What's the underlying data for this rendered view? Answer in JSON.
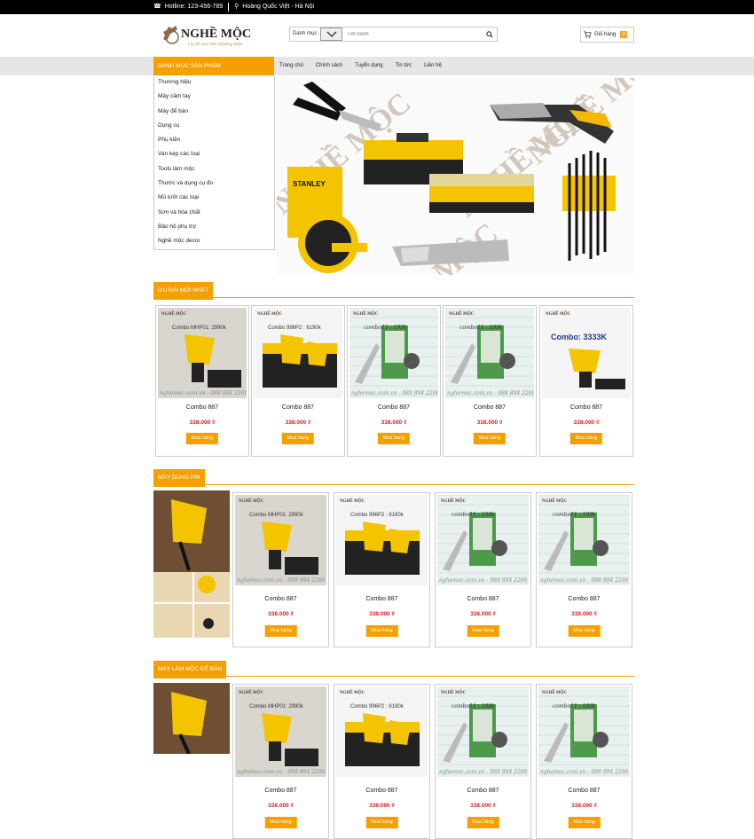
{
  "topbar": {
    "hotline": "Hotline: 123-456-789",
    "address": "Hoàng Quốc Việt - Hà Nội"
  },
  "logo": {
    "text": "NGHỀ MỘC",
    "tagline": "Uy tín tạo nên thương hiệu"
  },
  "search": {
    "category_label": "Danh mục",
    "placeholder": "Tìm kiếm"
  },
  "cart": {
    "label": "Giỏ hàng",
    "count": "0"
  },
  "nav": {
    "category_title": "Danh mục sản phẩm",
    "links": [
      "Trang chủ",
      "Chính sách",
      "Tuyển dụng",
      "Tin tức",
      "Liên hệ"
    ]
  },
  "categories": [
    "Thương hiệu",
    "Máy cầm tay",
    "Máy để bàn",
    "Dụng cụ",
    "Phụ kiện",
    "Van kẹp các loại",
    "Tools làm mộc",
    "Thước và dụng cụ đo",
    "Mũ lưỡi các loại",
    "Sơn và hóa chất",
    "Bảo hộ phụ trợ",
    "Nghề mộc decor"
  ],
  "banner": {
    "watermark": "NGHỀ MỘC",
    "stanley": "STANLEY"
  },
  "sections": [
    {
      "title": "Ưu đãi mới nhất",
      "products": [
        {
          "name": "Combo 887",
          "price": "338.000 ₫",
          "button": "Mua hàng",
          "caption": "Combo MHP01: 2990k",
          "kind": "drill"
        },
        {
          "name": "Combo 887",
          "price": "338.000 ₫",
          "button": "Mua hàng",
          "caption": "Combo 996P2 : 6190k",
          "kind": "case"
        },
        {
          "name": "Combo 887",
          "price": "338.000 ₫",
          "button": "Mua hàng",
          "caption": "combo11 : 199k",
          "kind": "ruler"
        },
        {
          "name": "Combo 887",
          "price": "338.000 ₫",
          "button": "Mua hàng",
          "caption": "combo11 : 199k",
          "kind": "ruler"
        },
        {
          "name": "Combo 887",
          "price": "338.000 ₫",
          "button": "Mua hàng",
          "caption": "Combo: 3333K",
          "kind": "drill2"
        }
      ]
    },
    {
      "title": "Máy dùng pin",
      "products": [
        {
          "name": "Combo 887",
          "price": "338.000 ₫",
          "button": "Mua hàng",
          "caption": "Combo MHP01: 2990k",
          "kind": "drill"
        },
        {
          "name": "Combo 887",
          "price": "338.000 ₫",
          "button": "Mua hàng",
          "caption": "Combo 996P2 : 6190k",
          "kind": "case"
        },
        {
          "name": "Combo 887",
          "price": "338.000 ₫",
          "button": "Mua hàng",
          "caption": "combo11 : 199k",
          "kind": "ruler"
        },
        {
          "name": "Combo 887",
          "price": "338.000 ₫",
          "button": "Mua hàng",
          "caption": "combo11 : 199k",
          "kind": "ruler"
        }
      ]
    },
    {
      "title": "Máy làm mộc để bàn",
      "products": [
        {
          "name": "Combo 887",
          "price": "338.000 ₫",
          "button": "Mua hàng",
          "caption": "Combo MHP01: 2990k",
          "kind": "drill"
        },
        {
          "name": "Combo 887",
          "price": "338.000 ₫",
          "button": "Mua hàng",
          "caption": "Combo 996P2 : 6190k",
          "kind": "case"
        },
        {
          "name": "Combo 887",
          "price": "338.000 ₫",
          "button": "Mua hàng",
          "caption": "combo11 : 199k",
          "kind": "ruler"
        },
        {
          "name": "Combo 887",
          "price": "338.000 ₫",
          "button": "Mua hàng",
          "caption": "combo11 : 199k",
          "kind": "ruler"
        }
      ]
    }
  ],
  "watermark_site": "nghemoc.com.vn - 088 894 2266",
  "colors": {
    "accent": "#f5a000",
    "price": "#e02020",
    "topbar": "#000000"
  }
}
